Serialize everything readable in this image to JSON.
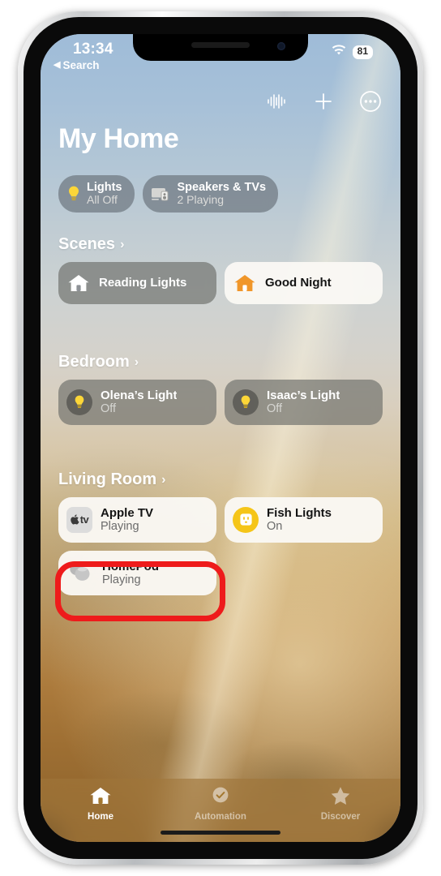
{
  "status_bar": {
    "time": "13:34",
    "back_label": "Search",
    "back_chevron": "◀",
    "wifi_icon": "wifi-icon",
    "battery_level": "81"
  },
  "toolbar": {
    "items": [
      {
        "name": "waveform-icon",
        "label": "Siri waveform"
      },
      {
        "name": "plus-icon",
        "label": "Add"
      },
      {
        "name": "more-options-icon",
        "label": "More"
      }
    ]
  },
  "header": {
    "title": "My Home"
  },
  "status_pills": [
    {
      "icon": "lightbulb-icon",
      "title": "Lights",
      "subtitle": "All Off"
    },
    {
      "icon": "speakers-tv-icon",
      "title": "Speakers & TVs",
      "subtitle": "2 Playing"
    }
  ],
  "sections": [
    {
      "name": "scenes",
      "title": "Scenes",
      "chevron": "›",
      "cards": [
        {
          "name": "scene-reading-lights",
          "icon": "house-icon",
          "icon_style": "plain-white",
          "title": "Reading Lights",
          "subtitle": "",
          "state": "off"
        },
        {
          "name": "scene-good-night",
          "icon": "house-icon",
          "icon_style": "plain-orange",
          "title": "Good Night",
          "subtitle": "",
          "state": "on"
        }
      ]
    },
    {
      "name": "bedroom",
      "title": "Bedroom",
      "chevron": "›",
      "cards": [
        {
          "name": "accessory-olenas-light",
          "icon": "lightbulb-icon",
          "icon_style": "circle-dark",
          "title": "Olena’s Light",
          "subtitle": "Off",
          "state": "off"
        },
        {
          "name": "accessory-isaacs-light",
          "icon": "lightbulb-icon",
          "icon_style": "circle-dark",
          "title": "Isaac’s Light",
          "subtitle": "Off",
          "state": "off"
        }
      ]
    },
    {
      "name": "living-room",
      "title": "Living Room",
      "chevron": "›",
      "cards": [
        {
          "name": "accessory-apple-tv",
          "icon": "apple-tv-icon",
          "icon_style": "square-gray",
          "title": "Apple TV",
          "subtitle": "Playing",
          "state": "on"
        },
        {
          "name": "accessory-fish-lights",
          "icon": "outlet-icon",
          "icon_style": "circle-yellow",
          "title": "Fish Lights",
          "subtitle": "On",
          "state": "on"
        },
        {
          "name": "accessory-homepod",
          "icon": "homepod-icon",
          "icon_style": "plain-gray",
          "title": "HomePod",
          "subtitle": "Playing",
          "state": "on",
          "highlighted": true
        }
      ]
    }
  ],
  "annotation": {
    "target": "accessory-homepod",
    "color": "#ee1b1b"
  },
  "tab_bar": [
    {
      "name": "tab-home",
      "icon": "house-icon",
      "label": "Home",
      "active": true
    },
    {
      "name": "tab-automation",
      "icon": "clock-check-icon",
      "label": "Automation",
      "active": false
    },
    {
      "name": "tab-discover",
      "icon": "star-icon",
      "label": "Discover",
      "active": false
    }
  ],
  "colors": {
    "accent_orange": "#f0962a",
    "bulb_yellow": "#f5c518",
    "highlight_red": "#ee1b1b",
    "card_on_bg": "#faf8f4"
  }
}
